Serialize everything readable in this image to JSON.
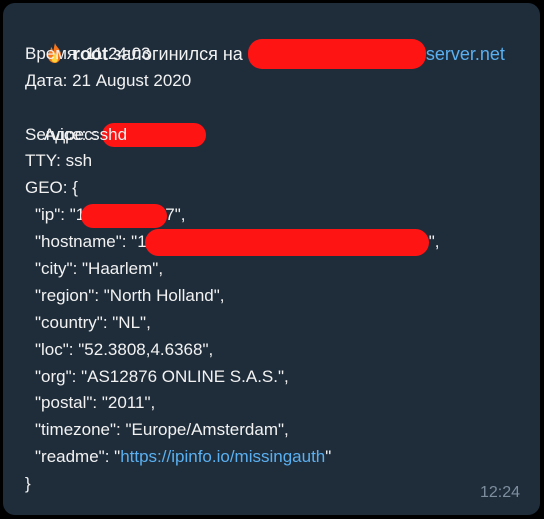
{
  "message": {
    "header": {
      "user": "root",
      "action": " залогинился на ",
      "server_suffix": "server.net"
    },
    "time_line": "Время: 11:24:03",
    "date_line": "Дата: 21 August 2020",
    "address_label": "Адрес: ",
    "service_line": "Service: sshd",
    "tty_line": "TTY: ssh",
    "geo_open": "GEO: {",
    "geo": {
      "ip_prefix": "\"ip\": \"",
      "ip_visible_start": "1",
      "ip_visible_end": "7",
      "ip_suffix": "\",",
      "hostname_prefix": "\"hostname\": \"",
      "hostname_visible_start": "1",
      "hostname_suffix": "\",",
      "city": "\"city\": \"Haarlem\",",
      "region": "\"region\": \"North Holland\",",
      "country": "\"country\": \"NL\",",
      "loc": "\"loc\": \"52.3808,4.6368\",",
      "org": "\"org\": \"AS12876 ONLINE S.A.S.\",",
      "postal": "\"postal\": \"2011\",",
      "timezone": "\"timezone\": \"Europe/Amsterdam\",",
      "readme_prefix": "\"readme\": \"",
      "readme_link": "https://ipinfo.io/missingauth",
      "readme_suffix": "\""
    },
    "geo_close": "}",
    "timestamp": "12:24"
  },
  "colors": {
    "bubble": "#1f2d3b",
    "text": "#f2f2f2",
    "link": "#5ab0f0",
    "redaction": "#ff1414",
    "timestamp": "#7e8e9e"
  },
  "icons": {
    "header": "fire-icon"
  }
}
